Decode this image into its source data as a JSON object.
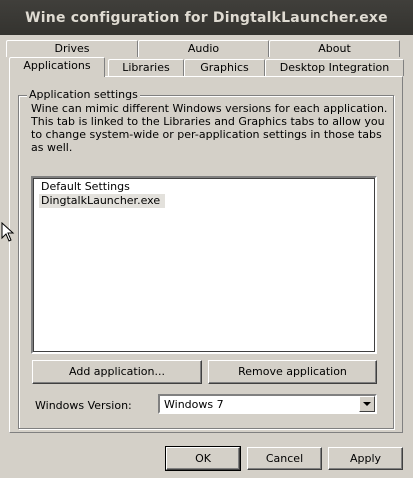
{
  "window": {
    "title": "Wine configuration for DingtalkLauncher.exe"
  },
  "tabs_back": [
    {
      "label": "Drives"
    },
    {
      "label": "Audio"
    },
    {
      "label": "About"
    }
  ],
  "tabs_front": [
    {
      "label": "Applications",
      "active": true
    },
    {
      "label": "Libraries"
    },
    {
      "label": "Graphics"
    },
    {
      "label": "Desktop Integration"
    }
  ],
  "app_settings": {
    "legend": "Application settings",
    "description": "Wine can mimic different Windows versions for each application. This tab is linked to the Libraries and Graphics tabs to allow you to change system-wide or per-application settings in those tabs as well.",
    "list_items": [
      "Default Settings",
      "DingtalkLauncher.exe"
    ],
    "selected_item": "DingtalkLauncher.exe",
    "add_button": "Add application...",
    "remove_button": "Remove application",
    "version_label": "Windows Version:",
    "version_value": "Windows 7"
  },
  "footer": {
    "ok": "OK",
    "cancel": "Cancel",
    "apply": "Apply"
  },
  "colors": {
    "face": "#d4d0c8",
    "titlebar": "#3c3b37",
    "title_text": "#dfdbd2",
    "selected": "#e3e1dc"
  }
}
